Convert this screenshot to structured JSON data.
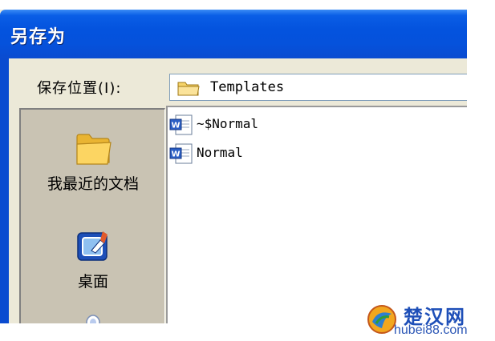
{
  "window": {
    "title": "另存为"
  },
  "save_in": {
    "label": "保存位置(I):",
    "value": "Templates"
  },
  "places": [
    {
      "label": "我最近的文档",
      "icon": "folder-icon"
    },
    {
      "label": "桌面",
      "icon": "desktop-icon"
    },
    {
      "label": "",
      "icon": "my-documents-icon"
    }
  ],
  "files": [
    {
      "name": "~$Normal",
      "icon": "word-document-icon"
    },
    {
      "name": "Normal",
      "icon": "word-document-icon"
    }
  ],
  "watermark": {
    "brand": "楚汉网",
    "url": "hubei88.com"
  },
  "colors": {
    "titlebar": "#0552dc",
    "dialog_bg": "#ece9d8",
    "places_bg": "#c9c3b3",
    "folder": "#f3c94b"
  }
}
